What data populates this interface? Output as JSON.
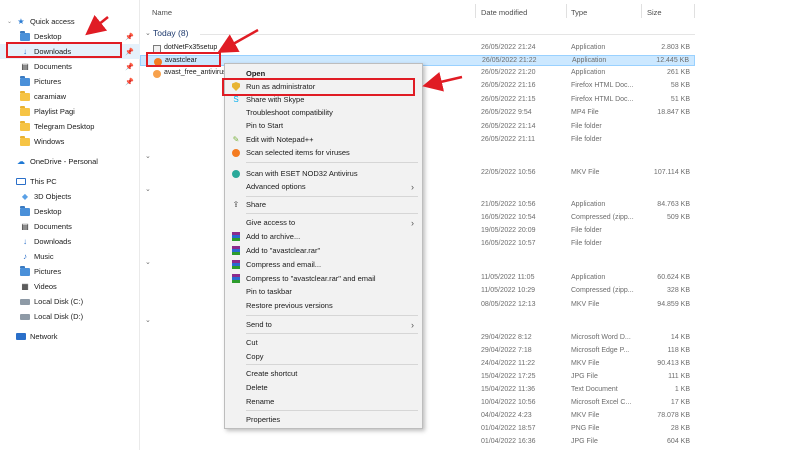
{
  "sidebar": {
    "items": [
      {
        "label": "Quick access",
        "icon": "star-icon"
      },
      {
        "label": "Desktop",
        "icon": "folder-icon"
      },
      {
        "label": "Downloads",
        "icon": "download-icon"
      },
      {
        "label": "Documents",
        "icon": "document-icon"
      },
      {
        "label": "Pictures",
        "icon": "picture-icon"
      },
      {
        "label": "caramiaw",
        "icon": "folder-icon"
      },
      {
        "label": "Playlist Pagi",
        "icon": "folder-icon"
      },
      {
        "label": "Telegram Desktop",
        "icon": "folder-icon"
      },
      {
        "label": "Windows",
        "icon": "folder-icon"
      },
      {
        "label": "OneDrive - Personal",
        "icon": "cloud-icon"
      },
      {
        "label": "This PC",
        "icon": "pc-icon"
      },
      {
        "label": "3D Objects",
        "icon": "cube-icon"
      },
      {
        "label": "Desktop",
        "icon": "folder-icon"
      },
      {
        "label": "Documents",
        "icon": "document-icon"
      },
      {
        "label": "Downloads",
        "icon": "download-icon"
      },
      {
        "label": "Music",
        "icon": "music-icon"
      },
      {
        "label": "Pictures",
        "icon": "picture-icon"
      },
      {
        "label": "Videos",
        "icon": "video-icon"
      },
      {
        "label": "Local Disk (C:)",
        "icon": "disk-icon"
      },
      {
        "label": "Local Disk (D:)",
        "icon": "disk-icon"
      },
      {
        "label": "Network",
        "icon": "network-icon"
      }
    ]
  },
  "columns": {
    "name": "Name",
    "date": "Date modified",
    "type": "Type",
    "size": "Size"
  },
  "group": {
    "today": "Today (8)"
  },
  "rows": [
    {
      "name": "dotNetFx35setup",
      "date": "26/05/2022 21:24",
      "type": "Application",
      "size": "2.803 KB"
    },
    {
      "name": "avastclear",
      "date": "26/05/2022 21:22",
      "type": "Application",
      "size": "12.445 KB"
    },
    {
      "name": "avast_free_antivirus",
      "date": "26/05/2022 21:20",
      "type": "Application",
      "size": "261 KB"
    },
    {
      "name": "",
      "date": "26/05/2022 21:16",
      "type": "Firefox HTML Doc...",
      "size": "58 KB"
    },
    {
      "name": "",
      "date": "26/05/2022 21:15",
      "type": "Firefox HTML Doc...",
      "size": "51 KB"
    },
    {
      "name": "",
      "date": "26/05/2022 9:54",
      "type": "MP4 File",
      "size": "18.847 KB"
    },
    {
      "name": "",
      "date": "26/05/2022 21:14",
      "type": "File folder",
      "size": ""
    },
    {
      "name": "",
      "date": "26/05/2022 21:11",
      "type": "File folder",
      "size": ""
    },
    {
      "name": "",
      "date": "22/05/2022 10:56",
      "type": "MKV File",
      "size": "107.114 KB"
    },
    {
      "name": "",
      "date": "21/05/2022 10:56",
      "type": "Application",
      "size": "84.763 KB"
    },
    {
      "name": "",
      "date": "16/05/2022 10:54",
      "type": "Compressed (zipp...",
      "size": "509 KB"
    },
    {
      "name": "",
      "date": "19/05/2022 20:09",
      "type": "File folder",
      "size": ""
    },
    {
      "name": "",
      "date": "16/05/2022 10:57",
      "type": "File folder",
      "size": ""
    },
    {
      "name": "",
      "date": "11/05/2022 11:05",
      "type": "Application",
      "size": "60.624 KB"
    },
    {
      "name": "",
      "date": "11/05/2022 10:29",
      "type": "Compressed (zipp...",
      "size": "328 KB"
    },
    {
      "name": "",
      "date": "08/05/2022 12:13",
      "type": "MKV File",
      "size": "94.859 KB"
    },
    {
      "name": "",
      "date": "29/04/2022 8:12",
      "type": "Microsoft Word D...",
      "size": "14 KB"
    },
    {
      "name": "",
      "date": "29/04/2022 7:18",
      "type": "Microsoft Edge P...",
      "size": "118 KB"
    },
    {
      "name": "",
      "date": "24/04/2022 11:22",
      "type": "MKV File",
      "size": "90.413 KB"
    },
    {
      "name": "",
      "date": "15/04/2022 17:25",
      "type": "JPG File",
      "size": "111 KB"
    },
    {
      "name": "",
      "date": "15/04/2022 11:36",
      "type": "Text Document",
      "size": "1 KB"
    },
    {
      "name": "",
      "date": "10/04/2022 10:56",
      "type": "Microsoft Excel C...",
      "size": "17 KB"
    },
    {
      "name": "",
      "date": "04/04/2022 4:23",
      "type": "MKV File",
      "size": "78.078 KB"
    },
    {
      "name": "",
      "date": "01/04/2022 18:57",
      "type": "PNG File",
      "size": "28 KB"
    },
    {
      "name": "",
      "date": "01/04/2022 16:36",
      "type": "JPG File",
      "size": "604 KB"
    }
  ],
  "context_menu": {
    "items": [
      {
        "label": "Open",
        "icon": ""
      },
      {
        "label": "Run as administrator",
        "icon": "shield-icon"
      },
      {
        "label": "Share with Skype",
        "icon": "skype-icon"
      },
      {
        "label": "Troubleshoot compatibility",
        "icon": ""
      },
      {
        "label": "Pin to Start",
        "icon": ""
      },
      {
        "label": "Edit with Notepad++",
        "icon": "notepad-icon"
      },
      {
        "label": "Scan selected items for viruses",
        "icon": "avast-icon"
      },
      {
        "label": "Scan with ESET NOD32 Antivirus",
        "icon": "eset-icon"
      },
      {
        "label": "Advanced options",
        "icon": ""
      },
      {
        "label": "Share",
        "icon": "share-icon"
      },
      {
        "label": "Give access to",
        "icon": ""
      },
      {
        "label": "Add to archive...",
        "icon": "winrar-icon"
      },
      {
        "label": "Add to \"avastclear.rar\"",
        "icon": "winrar-icon"
      },
      {
        "label": "Compress and email...",
        "icon": "winrar-icon"
      },
      {
        "label": "Compress to \"avastclear.rar\" and email",
        "icon": "winrar-icon"
      },
      {
        "label": "Pin to taskbar",
        "icon": ""
      },
      {
        "label": "Restore previous versions",
        "icon": ""
      },
      {
        "label": "Send to",
        "icon": ""
      },
      {
        "label": "Cut",
        "icon": ""
      },
      {
        "label": "Copy",
        "icon": ""
      },
      {
        "label": "Create shortcut",
        "icon": ""
      },
      {
        "label": "Delete",
        "icon": ""
      },
      {
        "label": "Rename",
        "icon": ""
      },
      {
        "label": "Properties",
        "icon": ""
      }
    ]
  },
  "colors": {
    "annotation": "#e01c24",
    "selection": "#cce8ff",
    "menu_bg": "#f2f2f2"
  }
}
